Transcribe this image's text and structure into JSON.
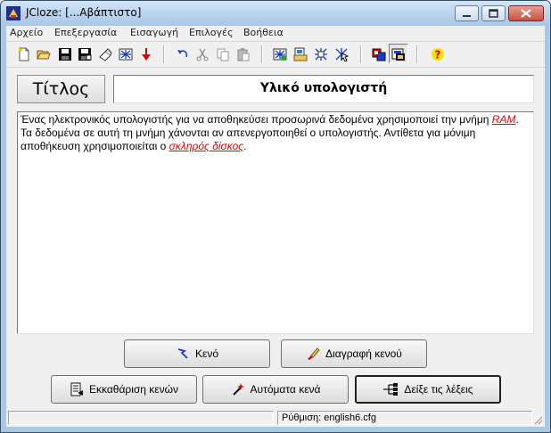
{
  "window": {
    "title": "JCloze: [...Αβάπτιστο]"
  },
  "menu": [
    "Αρχείο",
    "Επεξεργασία",
    "Εισαγωγή",
    "Επιλογές",
    "Βοήθεια"
  ],
  "toolbar_icons": [
    "new-file-icon",
    "open-folder-icon",
    "save-icon",
    "save-as-icon",
    "eraser-icon",
    "web-page-icon",
    "export-arrow-icon",
    "undo-icon",
    "cut-icon",
    "copy-icon",
    "paste-icon",
    "export-web-icon",
    "export-print-icon",
    "export-hot-icon",
    "export-drag-icon",
    "colors-icon",
    "config-icon",
    "help-icon"
  ],
  "title_button": "Τίτλος",
  "title_value": "Υλικό υπολογιστή",
  "text": {
    "part1": "Ένας ηλεκτρονικός υπολογιστής για να αποθηκεύσει προσωρινά δεδομένα χρησιμοποιεί την μνήμη ",
    "gap1": "RAM",
    "part2": ". Τα δεδομένα σε αυτή τη μνήμη χάνονται αν απενεργοποιηθεί ο υπολογιστής. Αντίθετα για μόνιμη αποθήκευση χρησιμοποιείται ο ",
    "gap2": "σκληρός δίσκος",
    "part3": "."
  },
  "buttons": {
    "gap": "Κενό",
    "delete_gap": "Διαγραφή κενού",
    "clear_gaps": "Εκκαθάριση κενών",
    "auto_gaps": "Αυτόματα κενά",
    "show_words": "Δείξε τις λέξεις"
  },
  "status": {
    "config": "Ρύθμιση: english6.cfg"
  },
  "colors": {
    "gap_text": "#e00000",
    "titlebar": "#bcd5ef",
    "face": "#f0f0f0"
  }
}
